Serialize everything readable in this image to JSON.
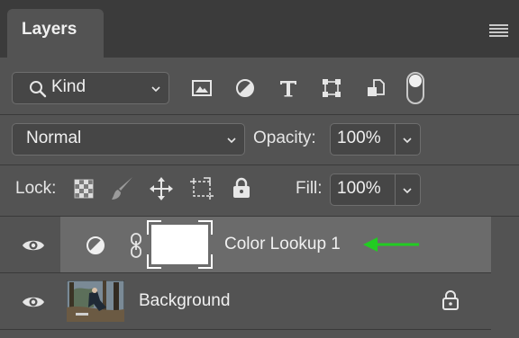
{
  "panel": {
    "tab_title": "Layers"
  },
  "filter": {
    "kind_label": "Kind"
  },
  "blend": {
    "mode": "Normal",
    "opacity_label": "Opacity:",
    "opacity_value": "100%"
  },
  "lock": {
    "lock_label": "Lock:",
    "fill_label": "Fill:",
    "fill_value": "100%"
  },
  "layers": [
    {
      "name": "Color Lookup 1",
      "type": "adjustment",
      "selected": true
    },
    {
      "name": "Background",
      "type": "pixel",
      "locked": true
    }
  ],
  "colors": {
    "annotation_arrow": "#22cc22",
    "selected_row": "#6b6b6b",
    "panel_bg": "#535353"
  }
}
